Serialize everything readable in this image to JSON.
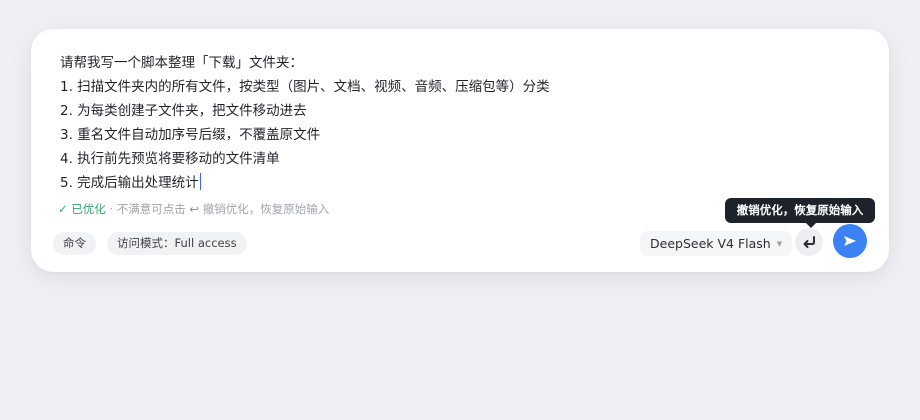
{
  "prompt": {
    "lines": [
      "请帮我写一个脚本整理「下载」文件夹：",
      "1. 扫描文件夹内的所有文件，按类型（图片、文档、视频、音频、压缩包等）分类",
      "2. 为每类创建子文件夹，把文件移动进去",
      "3. 重名文件自动加序号后缀，不覆盖原文件",
      "4. 执行前先预览将要移动的文件清单",
      "5. 完成后输出处理统计"
    ]
  },
  "status": {
    "optimized": "✓ 已优化",
    "hint_prefix": " · 不满意可点击 ",
    "undo_glyph": "↩",
    "hint_suffix": " 撤销优化，恢复原始输入"
  },
  "chips": {
    "command": "命令",
    "access": "访问模式：Full access"
  },
  "model": {
    "name": "DeepSeek V4 Flash"
  },
  "tooltip": {
    "text": "撤销优化，恢复原始输入"
  },
  "colors": {
    "accent": "#3b82f6",
    "success": "#2fa86e",
    "tooltip_bg": "#1e222b"
  },
  "icons": {
    "undo": "undo-arrow-icon",
    "send": "send-icon",
    "dropdown": "chevron-down-icon"
  }
}
